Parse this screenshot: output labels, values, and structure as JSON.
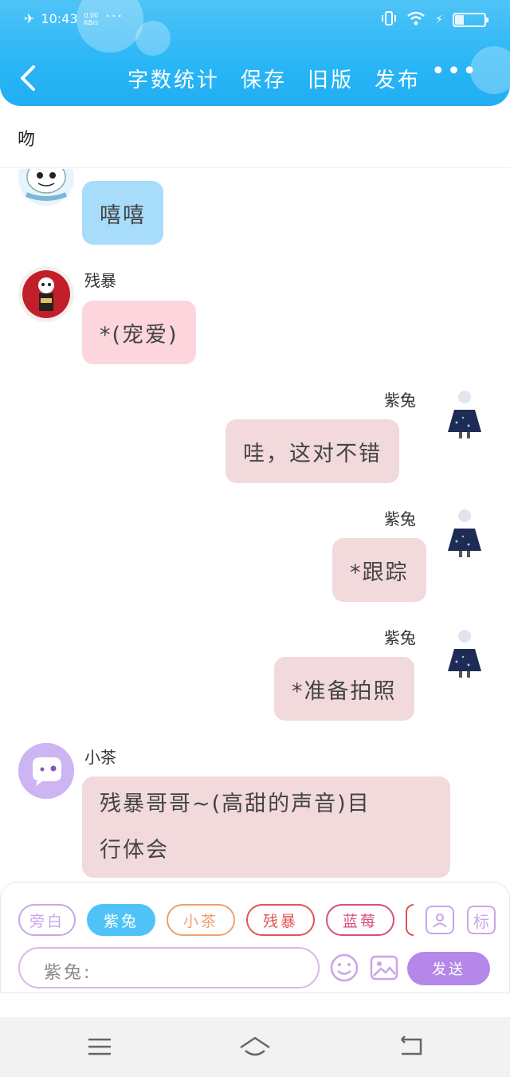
{
  "status_bar": {
    "time": "10:43",
    "net_speed_value": "0.00",
    "net_speed_unit": "KB/s",
    "dots": "···",
    "battery_level": "47"
  },
  "nav": {
    "actions": [
      "字数统计",
      "保存",
      "旧版",
      "发布"
    ],
    "more": "•••"
  },
  "title": "吻",
  "messages": [
    {
      "side": "left",
      "sender": "",
      "text": "嘻嘻",
      "color": "blue"
    },
    {
      "side": "left",
      "sender": "残暴",
      "text": "*(宠爱)",
      "color": "pink"
    },
    {
      "side": "right",
      "sender": "紫兔",
      "text": "哇，这对不错",
      "color": "rose"
    },
    {
      "side": "right",
      "sender": "紫兔",
      "text": "*跟踪",
      "color": "rose"
    },
    {
      "side": "right",
      "sender": "紫兔",
      "text": "*准备拍照",
      "color": "rose"
    },
    {
      "side": "left",
      "sender": "小茶",
      "text_line1": "残暴哥哥~(高甜的声音)目",
      "text_line2": "行体会",
      "color": "rose"
    }
  ],
  "toolbar": {
    "chips": [
      {
        "label": "旁白",
        "color": "#c9a6e8",
        "active": false
      },
      {
        "label": "紫兔",
        "color": "#4fc3f7",
        "active": true
      },
      {
        "label": "小茶",
        "color": "#f0a070",
        "active": false
      },
      {
        "label": "残暴",
        "color": "#e05555",
        "active": false
      },
      {
        "label": "蓝莓",
        "color": "#d94f7a",
        "active": false
      }
    ],
    "label_icon": "标",
    "input_prefix": "紫兔:",
    "send_label": "发送"
  },
  "colors": {
    "header": "#29b6f6",
    "send": "#b487e9",
    "bubble_blue": "#a7dcfb",
    "bubble_pink": "#fcd6dc",
    "bubble_rose": "#f1d9dc"
  }
}
